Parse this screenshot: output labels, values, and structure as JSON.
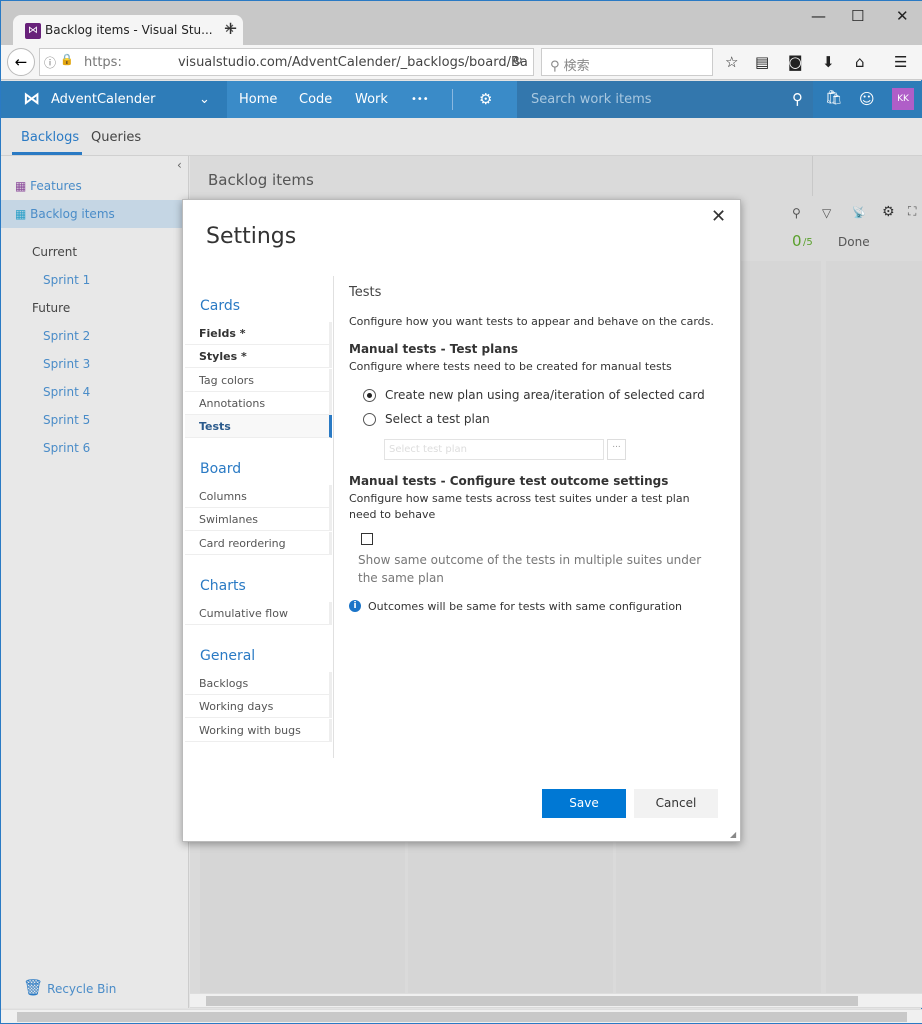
{
  "browser": {
    "tab_title": "Backlog items - Visual Stu...",
    "url_scheme": "https:",
    "url": "visualstudio.com/AdventCalender/_backlogs/board/Ba",
    "search_placeholder": "検索"
  },
  "header": {
    "project": "AdventCalender",
    "nav": [
      "Home",
      "Code",
      "Work",
      "•••"
    ],
    "search_placeholder": "Search work items",
    "avatar": "KK",
    "brand_color": "#2e7cb8",
    "avatar_color": "#b05ec8"
  },
  "hub": {
    "tabs": [
      "Backlogs",
      "Queries"
    ]
  },
  "sidebar": {
    "backlogs": [
      "Features",
      "Backlog items"
    ],
    "current_label": "Current",
    "current": [
      "Sprint 1"
    ],
    "future_label": "Future",
    "future": [
      "Sprint 2",
      "Sprint 3",
      "Sprint 4",
      "Sprint 5",
      "Sprint 6"
    ],
    "recycle_bin": "Recycle Bin"
  },
  "board": {
    "title": "Backlog items",
    "count": "0",
    "limit": "/5",
    "done": "Done"
  },
  "settings": {
    "title": "Settings",
    "groups": [
      {
        "label": "Cards",
        "items": [
          "Fields *",
          "Styles *",
          "Tag colors",
          "Annotations",
          "Tests"
        ]
      },
      {
        "label": "Board",
        "items": [
          "Columns",
          "Swimlanes",
          "Card reordering"
        ]
      },
      {
        "label": "Charts",
        "items": [
          "Cumulative flow"
        ]
      },
      {
        "label": "General",
        "items": [
          "Backlogs",
          "Working days",
          "Working with bugs"
        ]
      }
    ],
    "selected": "Tests",
    "content": {
      "heading": "Tests",
      "intro": "Configure how you want tests to appear and behave on the cards.",
      "plans_title": "Manual tests - Test plans",
      "plans_desc": "Configure where tests need to be created for manual tests",
      "option_new": "Create new plan using area/iteration of selected card",
      "option_select": "Select a test plan",
      "selected_option": "new",
      "plan_placeholder": "Select test plan",
      "browse": "...",
      "outcome_title": "Manual tests - Configure test outcome settings",
      "outcome_desc": "Configure how same tests across test suites under a test plan need to behave",
      "checkbox_label": "Show same outcome of the tests in multiple suites under the same plan",
      "checkbox_checked": false,
      "info": "Outcomes will be same for tests with same configuration"
    },
    "save": "Save",
    "cancel": "Cancel"
  }
}
